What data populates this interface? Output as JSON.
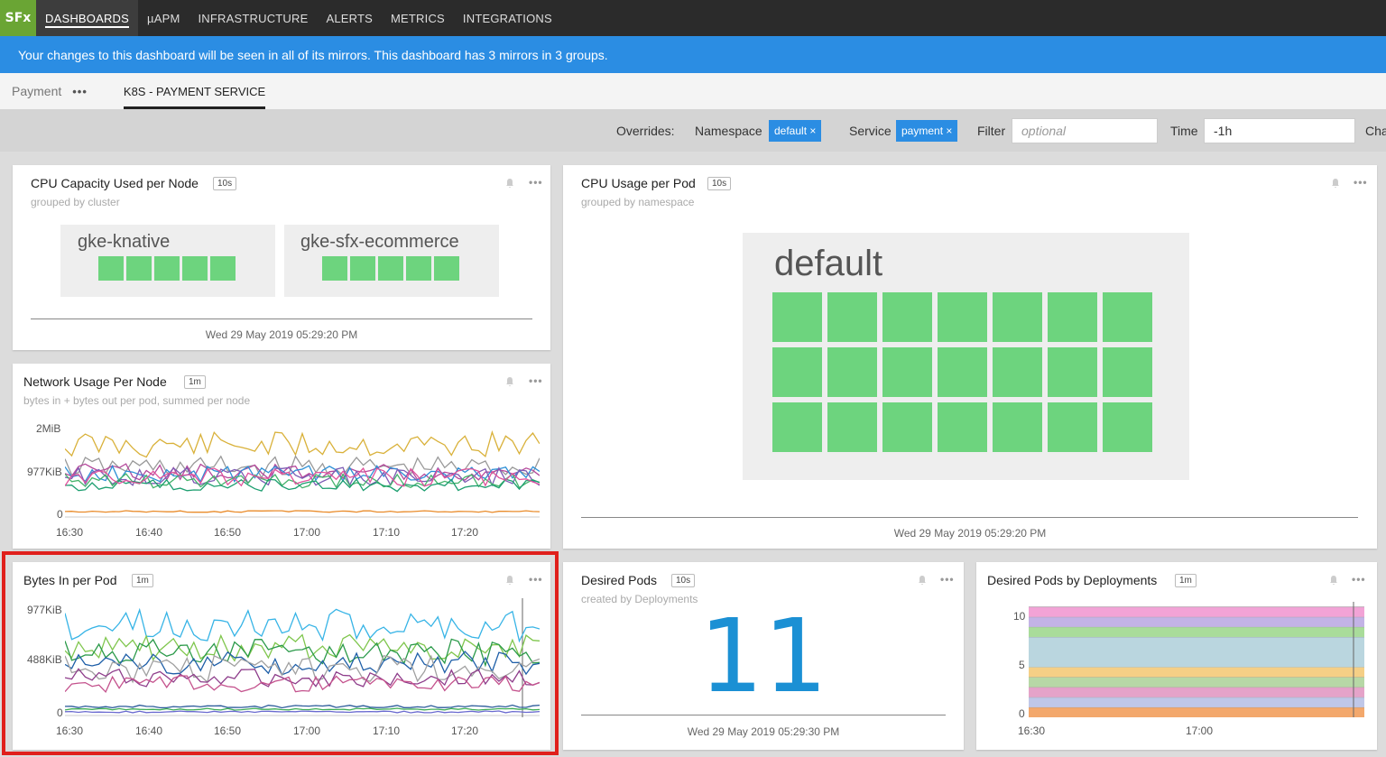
{
  "nav": {
    "logo": "SFx",
    "items": [
      "DASHBOARDS",
      "µAPM",
      "INFRASTRUCTURE",
      "ALERTS",
      "METRICS",
      "INTEGRATIONS"
    ]
  },
  "banner": {
    "text": "Your changes to this dashboard will be seen in all of its mirrors. This dashboard has 3 mirrors in 3 groups."
  },
  "tabs": {
    "group": "Payment",
    "more": "•••",
    "active_tab": "K8S - PAYMENT SERVICE"
  },
  "overrides": {
    "label": "Overrides:",
    "namespace_label": "Namespace",
    "namespace_value": "default ×",
    "service_label": "Service",
    "service_value": "payment ×",
    "filter_label": "Filter",
    "filter_placeholder": "optional",
    "time_label": "Time",
    "time_value": "-1h",
    "cut_label": "Cha"
  },
  "cards": {
    "cpu_capacity": {
      "title": "CPU Capacity Used per Node",
      "badge": "10s",
      "subtitle": "grouped by cluster",
      "groups": [
        {
          "name": "gke-knative",
          "cells": 5
        },
        {
          "name": "gke-sfx-ecommerce",
          "cells": 5
        }
      ],
      "timestamp": "Wed 29 May 2019 05:29:20 PM"
    },
    "cpu_usage_pod": {
      "title": "CPU Usage per Pod",
      "badge": "10s",
      "subtitle": "grouped by namespace",
      "group": {
        "name": "default",
        "cells": 21
      },
      "timestamp": "Wed 29 May 2019 05:29:20 PM"
    },
    "network_usage": {
      "title": "Network Usage Per Node",
      "badge": "1m",
      "subtitle": "bytes in + bytes out per pod, summed per node",
      "y_ticks": [
        "2MiB",
        "977KiB",
        "0"
      ],
      "x_ticks": [
        "16:30",
        "16:40",
        "16:50",
        "17:00",
        "17:10",
        "17:20"
      ]
    },
    "bytes_in": {
      "title": "Bytes In per Pod",
      "badge": "1m",
      "y_ticks": [
        "977KiB",
        "488KiB",
        "0"
      ],
      "x_ticks": [
        "16:30",
        "16:40",
        "16:50",
        "17:00",
        "17:10",
        "17:20"
      ]
    },
    "desired_pods": {
      "title": "Desired Pods",
      "badge": "10s",
      "subtitle": "created by Deployments",
      "value": "11",
      "timestamp": "Wed 29 May 2019 05:29:30 PM"
    },
    "desired_by_deploy": {
      "title": "Desired Pods by Deployments",
      "badge": "1m",
      "y_ticks": [
        "10",
        "5",
        "0"
      ],
      "x_ticks": [
        "16:30",
        "17:00"
      ]
    }
  },
  "colors": {
    "accent": "#2b8de3",
    "heat_cell": "#6dd47e",
    "big_number": "#1b90d4",
    "highlight": "#e0201c"
  }
}
